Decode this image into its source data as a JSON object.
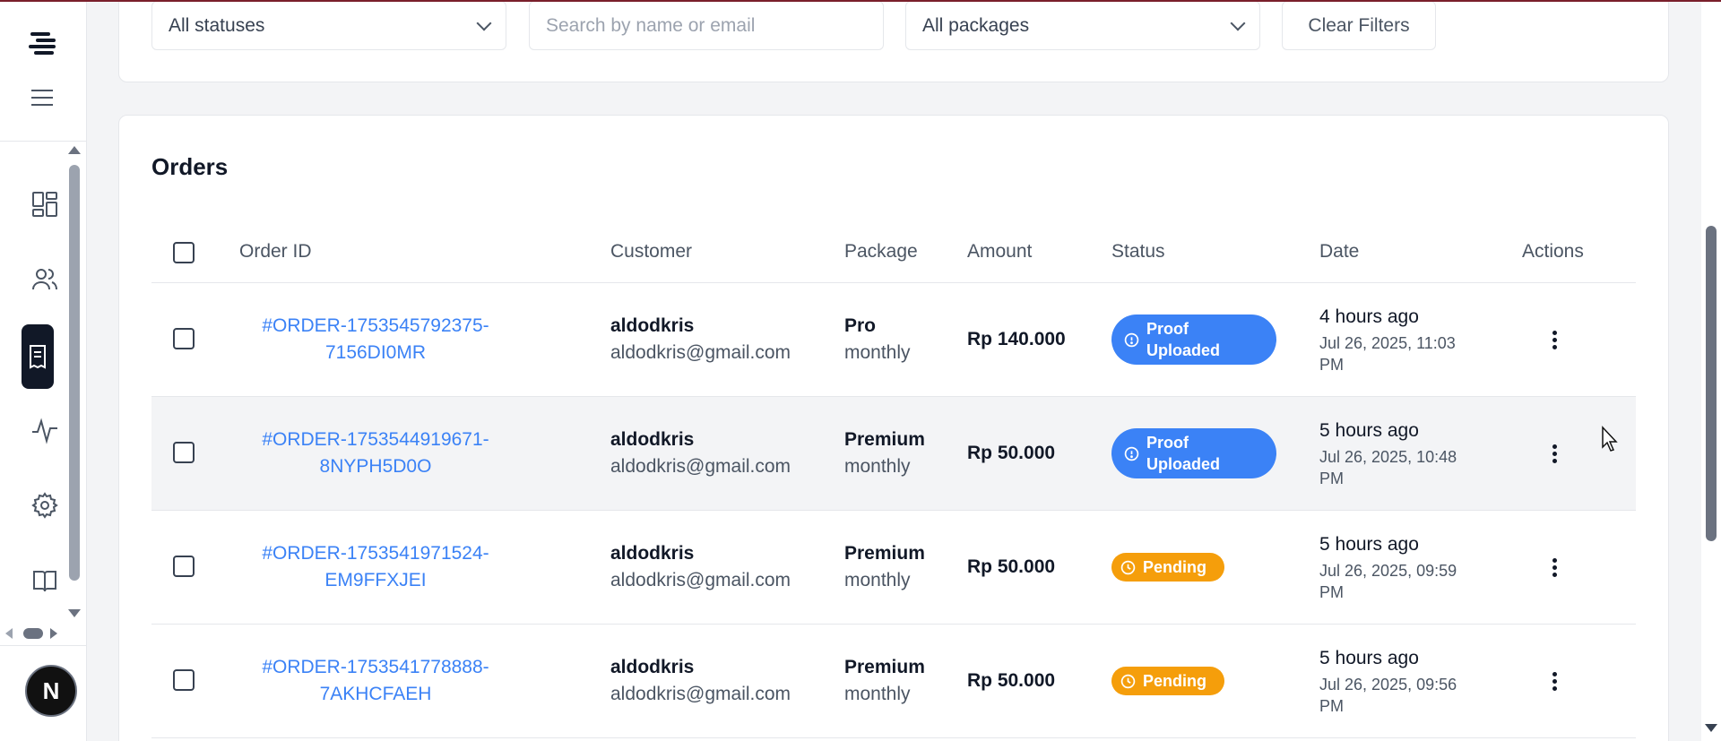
{
  "sidebar": {
    "logo": "brand-logo-icon",
    "menu_icon": "hamburger-menu-icon",
    "items": [
      {
        "icon": "dashboard-icon",
        "active": false
      },
      {
        "icon": "users-icon",
        "active": false
      },
      {
        "icon": "orders-receipt-icon",
        "active": true
      },
      {
        "icon": "activity-icon",
        "active": false
      },
      {
        "icon": "settings-gear-icon",
        "active": false
      },
      {
        "icon": "book-icon",
        "active": false
      }
    ],
    "avatar_letter": "N"
  },
  "filters": {
    "status_select": "All statuses",
    "search_placeholder": "Search by name or email",
    "package_select": "All packages",
    "clear_label": "Clear Filters"
  },
  "orders": {
    "title": "Orders",
    "columns": {
      "order_id": "Order ID",
      "customer": "Customer",
      "package": "Package",
      "amount": "Amount",
      "status": "Status",
      "date": "Date",
      "actions": "Actions"
    },
    "rows": [
      {
        "id_line1": "#ORDER-1753545792375-",
        "id_line2": "7156DI0MR",
        "customer_name": "aldodkris",
        "customer_email": "aldodkris@gmail.com",
        "package": "Pro",
        "cycle": "monthly",
        "amount": "Rp 140.000",
        "status_line1": "Proof",
        "status_line2": "Uploaded",
        "status_type": "proof",
        "date_relative": "4 hours ago",
        "date_line1": "Jul 26, 2025, 11:03",
        "date_line2": "PM"
      },
      {
        "id_line1": "#ORDER-1753544919671-",
        "id_line2": "8NYPH5D0O",
        "customer_name": "aldodkris",
        "customer_email": "aldodkris@gmail.com",
        "package": "Premium",
        "cycle": "monthly",
        "amount": "Rp 50.000",
        "status_line1": "Proof",
        "status_line2": "Uploaded",
        "status_type": "proof",
        "date_relative": "5 hours ago",
        "date_line1": "Jul 26, 2025, 10:48",
        "date_line2": "PM"
      },
      {
        "id_line1": "#ORDER-1753541971524-",
        "id_line2": "EM9FFXJEI",
        "customer_name": "aldodkris",
        "customer_email": "aldodkris@gmail.com",
        "package": "Premium",
        "cycle": "monthly",
        "amount": "Rp 50.000",
        "status_line1": "Pending",
        "status_line2": "",
        "status_type": "pending",
        "date_relative": "5 hours ago",
        "date_line1": "Jul 26, 2025, 09:59",
        "date_line2": "PM"
      },
      {
        "id_line1": "#ORDER-1753541778888-",
        "id_line2": "7AKHCFAEH",
        "customer_name": "aldodkris",
        "customer_email": "aldodkris@gmail.com",
        "package": "Premium",
        "cycle": "monthly",
        "amount": "Rp 50.000",
        "status_line1": "Pending",
        "status_line2": "",
        "status_type": "pending",
        "date_relative": "5 hours ago",
        "date_line1": "Jul 26, 2025, 09:56",
        "date_line2": "PM"
      }
    ]
  },
  "colors": {
    "link": "#3b82f6",
    "proof_badge": "#3b82f6",
    "pending_badge": "#f59e0b",
    "active_nav": "#111827"
  }
}
